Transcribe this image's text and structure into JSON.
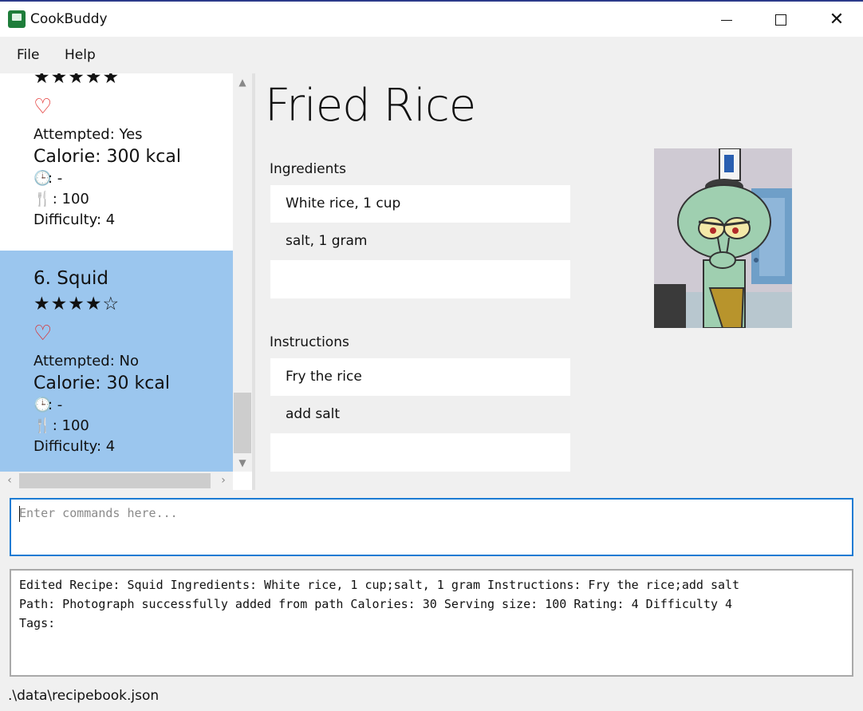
{
  "window": {
    "title": "CookBuddy",
    "minimize_icon": "minimize-icon",
    "maximize_icon": "maximize-icon",
    "close_icon": "close-icon",
    "close_glyph": "✕"
  },
  "menu": {
    "file": "File",
    "help": "Help"
  },
  "recipe_list": {
    "items": [
      {
        "stars": "★★★★★",
        "rating": 5,
        "heart": "♡",
        "attempted": "Attempted: Yes",
        "calorie": "Calorie: 300 kcal",
        "time": ": -",
        "serving": " : 100",
        "difficulty": "Difficulty: 4",
        "selected": false
      },
      {
        "index_name": "6.  Squid",
        "stars": "★★★★☆",
        "rating": 4,
        "heart": "♡",
        "attempted": "Attempted: No",
        "calorie": "Calorie: 30 kcal",
        "time": ": -",
        "serving": " : 100",
        "difficulty": "Difficulty: 4",
        "selected": true
      }
    ],
    "clock_glyph": "🕒",
    "utensils_glyph": "🍴",
    "selected_color": "#9bc6ee"
  },
  "detail": {
    "title": "Fried Rice",
    "ingredients_label": "Ingredients",
    "ingredients": [
      "White rice, 1 cup",
      "salt, 1 gram"
    ],
    "instructions_label": "Instructions",
    "instructions": [
      "Fry the rice",
      "add salt"
    ]
  },
  "command": {
    "placeholder": "Enter commands here...",
    "value": ""
  },
  "result": {
    "text": "Edited Recipe: Squid Ingredients: White rice, 1 cup;salt, 1 gram Instructions: Fry the rice;add salt\nPath: Photograph successfully added from path Calories: 30 Serving size: 100 Rating: 4 Difficulty 4\nTags:"
  },
  "status": {
    "path": ".\\data\\recipebook.json"
  },
  "colors": {
    "accent": "#1c7bd3",
    "heart": "#e0201e",
    "app_icon": "#1e7d3a"
  }
}
